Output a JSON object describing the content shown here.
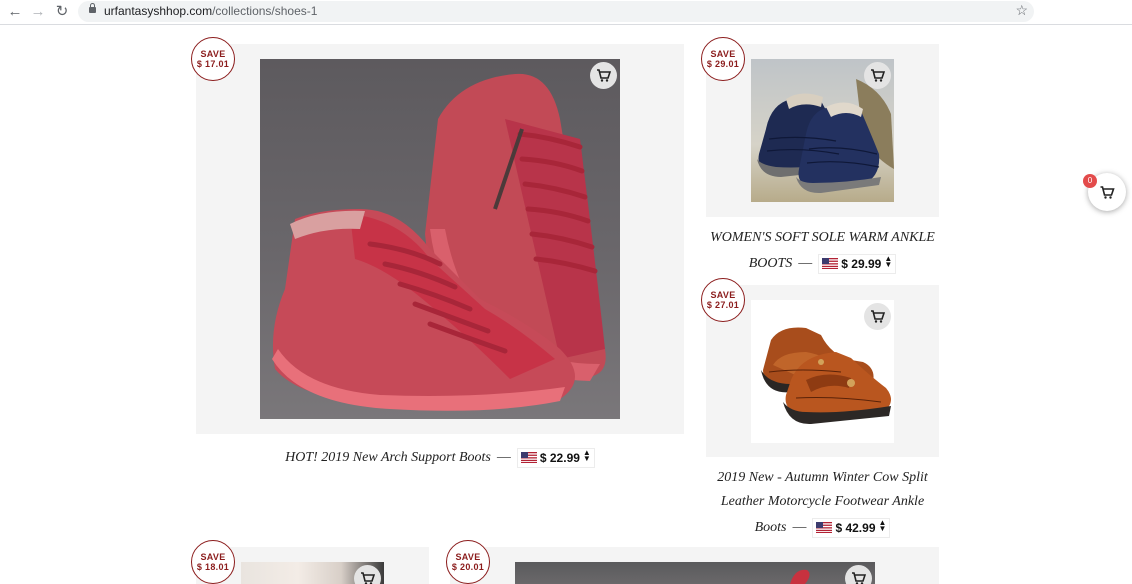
{
  "browser": {
    "back_icon": "arrow-left-icon",
    "forward_icon": "arrow-right-icon",
    "reload_icon": "reload-icon",
    "url_domain": "urfantasyshhop.com",
    "url_path": "/collections/shoes-1",
    "star_icon": "star-icon"
  },
  "colors": {
    "accent": "#8b1c1c",
    "panel": "#f4f4f4",
    "cart_badge": "#e34b4b"
  },
  "products": [
    {
      "save_label": "SAVE",
      "save_amount": "$ 17.01",
      "title": "HOT! 2019 New Arch Support Boots",
      "price": "$ 22.99"
    },
    {
      "save_label": "SAVE",
      "save_amount": "$ 29.01",
      "title_line1": "WOMEN'S SOFT SOLE WARM ANKLE",
      "title_line2": "BOOTS",
      "price": "$ 29.99"
    },
    {
      "save_label": "SAVE",
      "save_amount": "$ 27.01",
      "title_line1": "2019 New - Autumn Winter Cow Split",
      "title_line2": "Leather Motorcycle Footwear Ankle",
      "title_line3": "Boots",
      "price": "$ 42.99"
    },
    {
      "save_label": "SAVE",
      "save_amount": "$ 18.01"
    },
    {
      "save_label": "SAVE",
      "save_amount": "$ 20.01"
    }
  ],
  "separator": "—",
  "cart": {
    "count": "0",
    "icon": "shopping-cart-icon"
  }
}
